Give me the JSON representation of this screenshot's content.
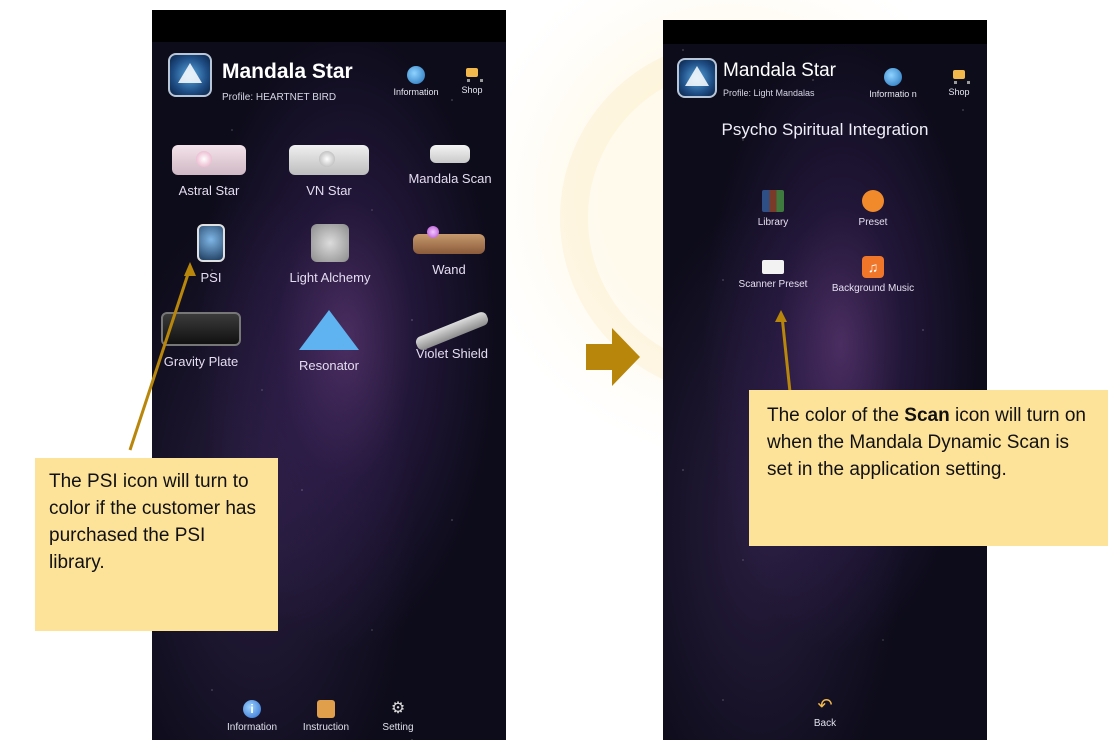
{
  "left_screen": {
    "app_title": "Mandala Star",
    "profile": "Profile: HEARTNET BIRD",
    "header_buttons": [
      {
        "label": "Information",
        "icon": "globe-icon"
      },
      {
        "label": "Shop",
        "icon": "cart-icon"
      }
    ],
    "devices": [
      {
        "label": "Astral Star",
        "icon": "projector-icon"
      },
      {
        "label": "VN Star",
        "icon": "projector-icon"
      },
      {
        "label": "Mandala Scan",
        "icon": "scanner-icon"
      },
      {
        "label": "PSI",
        "icon": "psi-head-icon"
      },
      {
        "label": "Light Alchemy",
        "icon": "light-icon"
      },
      {
        "label": "Wand",
        "icon": "wand-icon"
      },
      {
        "label": "Gravity Plate",
        "icon": "plate-icon"
      },
      {
        "label": "Resonator",
        "icon": "pyramid-icon"
      },
      {
        "label": "Violet Shield",
        "icon": "shield-icon"
      }
    ],
    "bottom_nav": [
      {
        "label": "Information",
        "icon": "info-icon"
      },
      {
        "label": "Instruction",
        "icon": "instruction-icon"
      },
      {
        "label": "Setting",
        "icon": "gear-icon"
      }
    ]
  },
  "right_screen": {
    "app_title": "Mandala Star",
    "profile": "Profile: Light Mandalas",
    "header_buttons": [
      {
        "label": "Informatio n",
        "icon": "globe-icon"
      },
      {
        "label": "Shop",
        "icon": "cart-icon"
      }
    ],
    "screen_title": "Psycho Spiritual Integration",
    "items": [
      {
        "label": "Library",
        "icon": "library-icon"
      },
      {
        "label": "Preset",
        "icon": "preset-icon"
      },
      {
        "label": "Scanner Preset",
        "icon": "scanner-icon"
      },
      {
        "label": "Background Music",
        "icon": "music-icon"
      }
    ],
    "back_label": "Back"
  },
  "callouts": {
    "left": "The PSI icon will turn to color if the customer has purchased the PSI library.",
    "right_pre": "The color of the ",
    "right_bold": "Scan",
    "right_post": " icon will turn on when the Mandala Dynamic Scan is set in the application setting."
  },
  "colors": {
    "callout_bg": "#fde29a",
    "arrow": "#b8860b",
    "phone_bg": "#0d0c1a"
  }
}
